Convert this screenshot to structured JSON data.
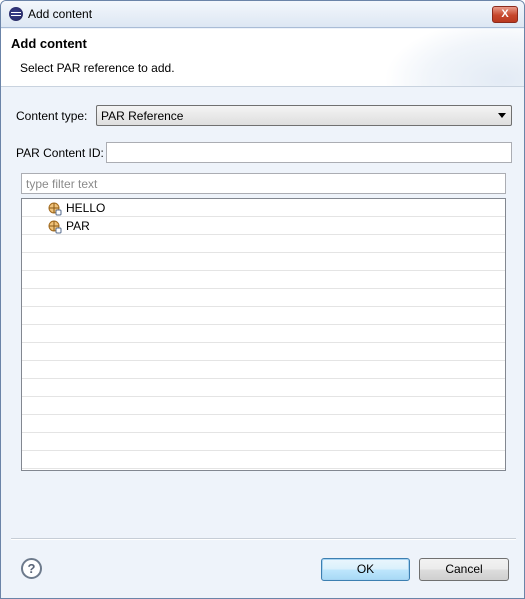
{
  "window": {
    "title": "Add content",
    "close_label": "X"
  },
  "header": {
    "title": "Add content",
    "message": "Select PAR reference to add."
  },
  "form": {
    "content_type_label": "Content type:",
    "content_type_value": "PAR Reference",
    "par_content_id_label": "PAR Content ID:",
    "par_content_id_value": "",
    "filter_placeholder": "type filter text"
  },
  "tree": {
    "items": [
      {
        "label": "HELLO",
        "icon": "par-package-icon"
      },
      {
        "label": "PAR",
        "icon": "par-package-icon"
      }
    ]
  },
  "footer": {
    "help_label": "?",
    "ok_label": "OK",
    "cancel_label": "Cancel"
  }
}
